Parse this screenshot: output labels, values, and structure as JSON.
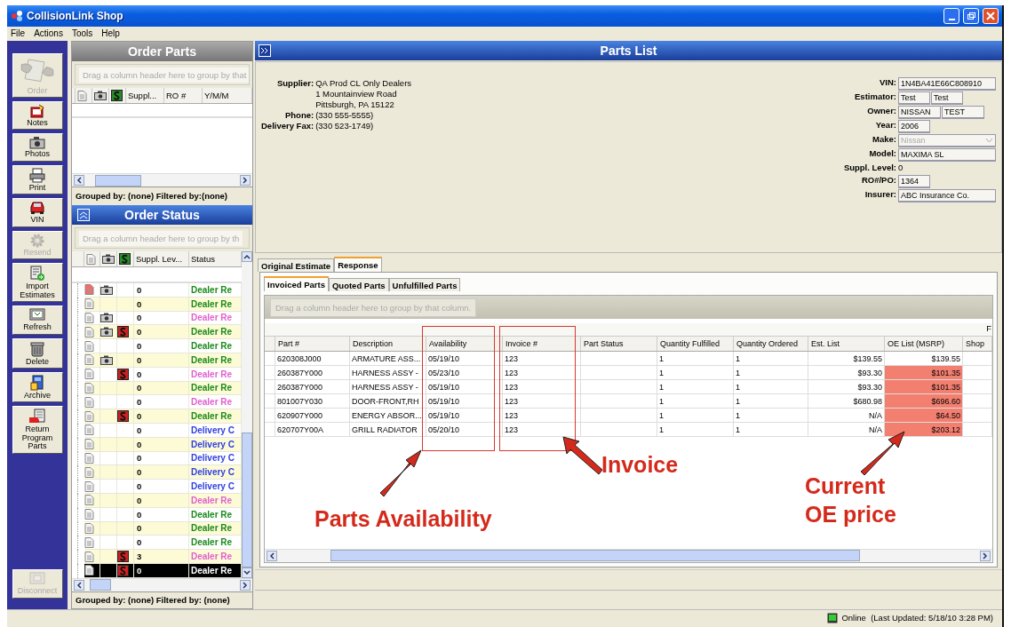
{
  "window": {
    "title": "CollisionLink Shop"
  },
  "menu": [
    "File",
    "Actions",
    "Tools",
    "Help"
  ],
  "toolbar": [
    {
      "label": "Order",
      "disabled": true
    },
    {
      "label": "Notes",
      "disabled": false
    },
    {
      "label": "Photos",
      "disabled": false
    },
    {
      "label": "Print",
      "disabled": false
    },
    {
      "label": "VIN",
      "disabled": false
    },
    {
      "label": "Resend",
      "disabled": true
    },
    {
      "label": "Import Estimates",
      "disabled": false
    },
    {
      "label": "Refresh",
      "disabled": false
    },
    {
      "label": "Delete",
      "disabled": false
    },
    {
      "label": "Archive",
      "disabled": false
    },
    {
      "label": "Return Program Parts",
      "disabled": false
    },
    {
      "label": "Disconnect",
      "disabled": true
    }
  ],
  "order_parts": {
    "title": "Order Parts",
    "group_hint": "Drag a column header here to group by that",
    "columns": [
      "Suppl...",
      "RO #",
      "Y/M/M"
    ],
    "footer": "Grouped by: (none) Filtered by:(none)"
  },
  "order_status": {
    "title": "Order Status",
    "group_hint": "Drag a column header here to group by th",
    "columns": [
      "Suppl. Lev...",
      "Status"
    ],
    "footer": "Grouped by: (none) Filtered by: (none)",
    "rows": [
      {
        "new": true,
        "photo": true,
        "supplement": false,
        "level": "0",
        "status": "Dealer Re",
        "color": "#1a8a1a",
        "selected": false
      },
      {
        "new": false,
        "photo": false,
        "supplement": false,
        "level": "0",
        "status": "Dealer Re",
        "color": "#1a8a1a",
        "selected": false
      },
      {
        "new": false,
        "photo": true,
        "supplement": false,
        "level": "0",
        "status": "Dealer Re",
        "color": "#e060d0",
        "selected": false
      },
      {
        "new": false,
        "photo": true,
        "supplement": true,
        "level": "0",
        "status": "Dealer Re",
        "color": "#1a8a1a",
        "selected": false
      },
      {
        "new": false,
        "photo": false,
        "supplement": false,
        "level": "0",
        "status": "Dealer Re",
        "color": "#1a8a1a",
        "selected": false
      },
      {
        "new": false,
        "photo": true,
        "supplement": false,
        "level": "0",
        "status": "Dealer Re",
        "color": "#1a8a1a",
        "selected": false
      },
      {
        "new": false,
        "photo": false,
        "supplement": true,
        "level": "0",
        "status": "Dealer Re",
        "color": "#e060d0",
        "selected": false
      },
      {
        "new": false,
        "photo": false,
        "supplement": false,
        "level": "0",
        "status": "Dealer Re",
        "color": "#1a8a1a",
        "selected": false
      },
      {
        "new": false,
        "photo": false,
        "supplement": false,
        "level": "0",
        "status": "Dealer Re",
        "color": "#e060d0",
        "selected": false
      },
      {
        "new": false,
        "photo": false,
        "supplement": true,
        "level": "0",
        "status": "Dealer Re",
        "color": "#1a8a1a",
        "selected": false
      },
      {
        "new": false,
        "photo": false,
        "supplement": false,
        "level": "0",
        "status": "Delivery C",
        "color": "#3040e0",
        "selected": false
      },
      {
        "new": false,
        "photo": false,
        "supplement": false,
        "level": "0",
        "status": "Delivery C",
        "color": "#3040e0",
        "selected": false
      },
      {
        "new": false,
        "photo": false,
        "supplement": false,
        "level": "0",
        "status": "Delivery C",
        "color": "#3040e0",
        "selected": false
      },
      {
        "new": false,
        "photo": false,
        "supplement": false,
        "level": "0",
        "status": "Delivery C",
        "color": "#3040e0",
        "selected": false
      },
      {
        "new": false,
        "photo": false,
        "supplement": false,
        "level": "0",
        "status": "Delivery C",
        "color": "#3040e0",
        "selected": false
      },
      {
        "new": false,
        "photo": false,
        "supplement": false,
        "level": "0",
        "status": "Dealer Re",
        "color": "#e060d0",
        "selected": false
      },
      {
        "new": false,
        "photo": false,
        "supplement": false,
        "level": "0",
        "status": "Dealer Re",
        "color": "#1a8a1a",
        "selected": false
      },
      {
        "new": false,
        "photo": false,
        "supplement": false,
        "level": "0",
        "status": "Dealer Re",
        "color": "#1a8a1a",
        "selected": false
      },
      {
        "new": false,
        "photo": false,
        "supplement": false,
        "level": "0",
        "status": "Dealer Re",
        "color": "#1a8a1a",
        "selected": false
      },
      {
        "new": false,
        "photo": false,
        "supplement": true,
        "level": "3",
        "status": "Dealer Re",
        "color": "#e060d0",
        "selected": false
      },
      {
        "new": false,
        "photo": false,
        "supplement": true,
        "level": "0",
        "status": "Dealer Re",
        "selected": true
      }
    ]
  },
  "parts_list": {
    "title": "Parts List",
    "supplier": [
      {
        "label": "Supplier:",
        "lines": [
          "QA Prod CL Only Dealers",
          "1 Mountainview Road",
          "Pittsburgh, PA 15122"
        ]
      },
      {
        "label": "Phone:",
        "lines": [
          "(330 555-5555)"
        ]
      },
      {
        "label": "Delivery Fax:",
        "lines": [
          "(330 523-1749)"
        ]
      }
    ],
    "vehicle": [
      {
        "label": "VIN:",
        "kind": "field",
        "values": [
          "1N4BA41E66C808910"
        ]
      },
      {
        "label": "Estimator:",
        "kind": "field",
        "values": [
          "Test",
          "Test"
        ]
      },
      {
        "label": "Owner:",
        "kind": "field",
        "values": [
          "NISSAN",
          "TEST"
        ]
      },
      {
        "label": "Year:",
        "kind": "field",
        "values": [
          "2006"
        ]
      },
      {
        "label": "Make:",
        "kind": "dropdown",
        "values": [
          "Nissan"
        ]
      },
      {
        "label": "Model:",
        "kind": "field",
        "values": [
          "MAXIMA SL"
        ]
      },
      {
        "label": "Suppl. Level:",
        "kind": "text",
        "values": [
          "0"
        ]
      },
      {
        "label": "RO#/PO:",
        "kind": "field",
        "values": [
          "1364"
        ]
      },
      {
        "label": "Insurer:",
        "kind": "field",
        "values": [
          "ABC Insurance Co."
        ]
      }
    ],
    "tabs": [
      {
        "label": "Original Estimate",
        "selected": false
      },
      {
        "label": "Response",
        "selected": true
      }
    ],
    "subtabs": [
      {
        "label": "Invoiced Parts",
        "selected": true
      },
      {
        "label": "Quoted Parts",
        "selected": false
      },
      {
        "label": "Unfulfilled Parts",
        "selected": false
      }
    ],
    "group_hint": "Drag a column header here to group by that column.",
    "band_label": "F",
    "columns": [
      "Part #",
      "Description",
      "Availability",
      "Invoice #",
      "Part Status",
      "Quantity Fulfilled",
      "Quantity Ordered",
      "Est. List",
      "OE List (MSRP)",
      "Shop"
    ],
    "rows": [
      {
        "part_no": "620308J000",
        "description": "ARMATURE ASS...",
        "availability": "05/19/10",
        "invoice_no": "123",
        "qty_fulfilled": "1",
        "qty_ordered": "1",
        "est_list": "$139.55",
        "oe_list": "$139.55",
        "oe_highlight": false
      },
      {
        "part_no": "260387Y000",
        "description": "HARNESS ASSY -",
        "availability": "05/23/10",
        "invoice_no": "123",
        "qty_fulfilled": "1",
        "qty_ordered": "1",
        "est_list": "$93.30",
        "oe_list": "$101.35",
        "oe_highlight": true
      },
      {
        "part_no": "260387Y000",
        "description": "HARNESS ASSY -",
        "availability": "05/19/10",
        "invoice_no": "123",
        "qty_fulfilled": "1",
        "qty_ordered": "1",
        "est_list": "$93.30",
        "oe_list": "$101.35",
        "oe_highlight": true
      },
      {
        "part_no": "801007Y030",
        "description": "DOOR-FRONT,RH",
        "availability": "05/19/10",
        "invoice_no": "123",
        "qty_fulfilled": "1",
        "qty_ordered": "1",
        "est_list": "$680.98",
        "oe_list": "$696.60",
        "oe_highlight": true
      },
      {
        "part_no": "620907Y000",
        "description": "ENERGY ABSOR...",
        "availability": "05/19/10",
        "invoice_no": "123",
        "qty_fulfilled": "1",
        "qty_ordered": "1",
        "est_list": "N/A",
        "oe_list": "$64.50",
        "oe_highlight": true
      },
      {
        "part_no": "620707Y00A",
        "description": "GRILL RADIATOR",
        "availability": "05/20/10",
        "invoice_no": "123",
        "qty_fulfilled": "1",
        "qty_ordered": "1",
        "est_list": "N/A",
        "oe_list": "$203.12",
        "oe_highlight": true
      }
    ]
  },
  "callouts": [
    {
      "text": "Parts Availability"
    },
    {
      "text": "Invoice"
    },
    {
      "text": "Current\nOE price"
    }
  ],
  "status_bar": {
    "text": "Online  (Last Updated: 5/18/10 3:28 PM)"
  }
}
